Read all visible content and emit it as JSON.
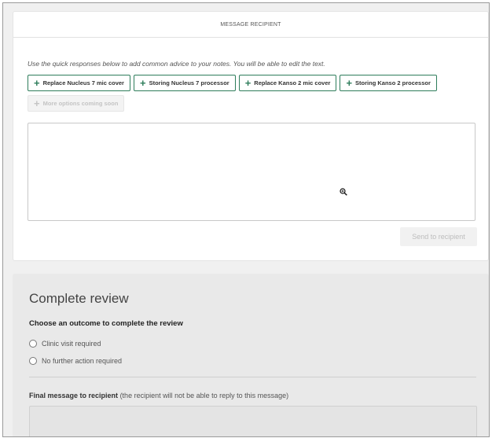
{
  "message_card": {
    "header": "MESSAGE RECIPIENT",
    "hint": "Use the quick responses below to add common advice to your notes. You will be able to edit the text.",
    "quick_responses": [
      {
        "label": "Replace Nucleus 7 mic cover"
      },
      {
        "label": "Storing Nucleus 7 processor"
      },
      {
        "label": "Replace Kanso 2 mic cover"
      },
      {
        "label": "Storing Kanso 2 processor"
      }
    ],
    "more_options": "More options coming soon",
    "send_button": "Send to recipient"
  },
  "review": {
    "title": "Complete review",
    "outcome_label": "Choose an outcome to complete the review",
    "options": [
      {
        "label": "Clinic visit required"
      },
      {
        "label": "No further action required"
      }
    ],
    "final_message_label": "Final message to recipient",
    "final_message_note": "(the recipient will not be able to reply to this message)"
  },
  "colors": {
    "accent": "#2e7d5b",
    "panel_bg": "#e9e9e9"
  },
  "icons": {
    "plus": "plus-icon",
    "zoom_cursor": "zoom-in-cursor-icon"
  }
}
